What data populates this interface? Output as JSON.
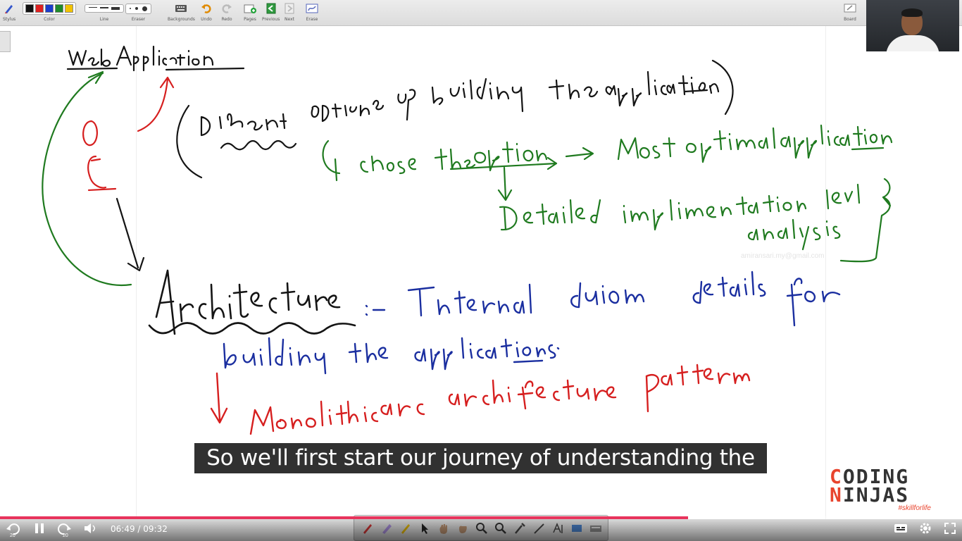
{
  "toolbar": {
    "stylus": "Stylus",
    "color": "Color",
    "line": "Line",
    "eraser": "Eraser",
    "backgrounds": "Backgrounds",
    "undo": "Undo",
    "redo": "Redo",
    "pages": "Pages",
    "previous": "Previous",
    "next": "Next",
    "erase": "Erase",
    "board": "Board",
    "swatch_colors": [
      "#111111",
      "#e02020",
      "#1a3ccc",
      "#1e8a2a",
      "#f2c200"
    ]
  },
  "whiteboard": {
    "notes": [
      "Web Application",
      "Different options of building the application",
      "choose the option",
      "Most optimal applications",
      "Detailed implementation level analysis",
      "OR",
      "Architecture",
      ":- Internal design details for building the applications.",
      "Monolithic architecture pattern"
    ],
    "watermark": "amiransari.my@gmail.com",
    "ink_colors": {
      "black": "#141414",
      "green": "#1f7a1f",
      "red": "#d61f1f",
      "blue": "#1b2fa0"
    }
  },
  "caption": "So we'll first start our journey of understanding the",
  "logo": {
    "line1": "ODING",
    "line2": "INJAS",
    "mark1": "C",
    "mark2": "N",
    "tagline": "#skillforlife"
  },
  "player": {
    "current_time": "06:49",
    "total_time": "09:32",
    "time_display": "06:49 / 09:32",
    "progress_fraction": 0.715,
    "skip_back": "20",
    "skip_forward": "20",
    "accent_color": "#e8345c"
  }
}
